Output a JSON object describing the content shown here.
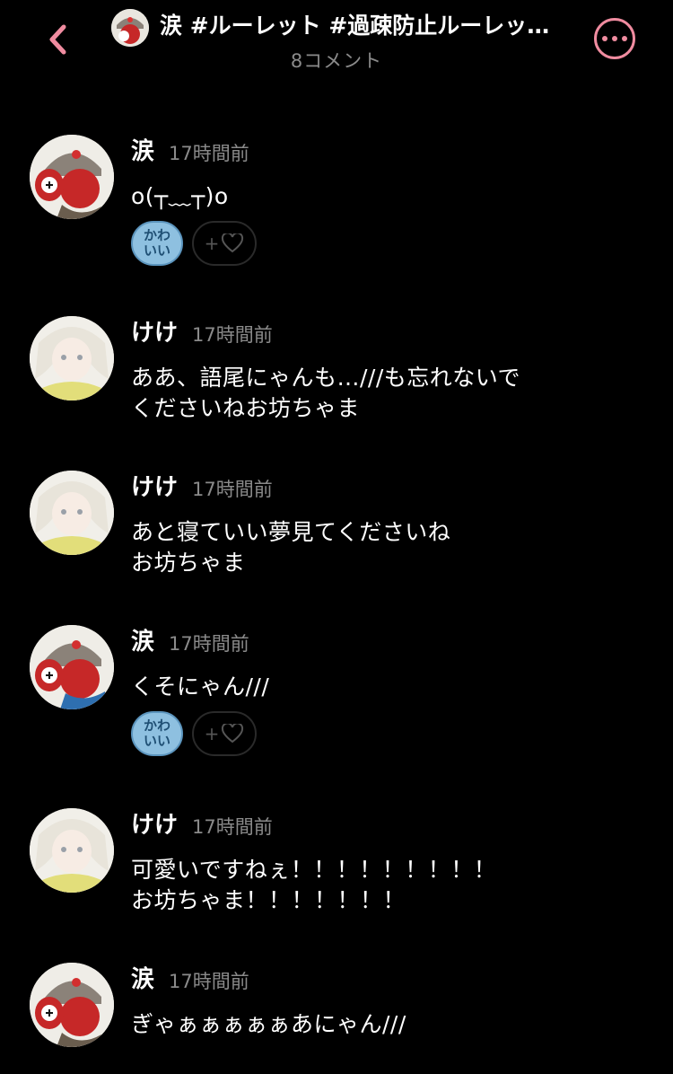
{
  "header": {
    "title": "涙 #ルーレット #過疎防止ルーレッ…",
    "subtitle": "8コメント",
    "accent": "#f08ca0"
  },
  "comments": [
    {
      "user": "涙",
      "time": "17時間前",
      "text": "o(┬﹏┬)o",
      "avatar": "avatar-rui",
      "reactions": {
        "kawaii": "かわいい",
        "add": "+"
      }
    },
    {
      "user": "けけ",
      "time": "17時間前",
      "text": "ああ、語尾にゃんも…///も忘れないで\nくださいねお坊ちゃま",
      "avatar": "avatar-keke"
    },
    {
      "user": "けけ",
      "time": "17時間前",
      "text": "あと寝ていい夢見てくださいね\nお坊ちゃま",
      "avatar": "avatar-keke"
    },
    {
      "user": "涙",
      "time": "17時間前",
      "text": "くそにゃん///",
      "avatar": "avatar-rui",
      "reactions": {
        "kawaii": "かわいい",
        "add": "+"
      }
    },
    {
      "user": "けけ",
      "time": "17時間前",
      "text": "可愛いですねぇ！！！！！！！！！\nお坊ちゃま！！！！！！！",
      "avatar": "avatar-keke"
    },
    {
      "user": "涙",
      "time": "17時間前",
      "text": "ぎゃぁぁぁぁぁあにゃん///",
      "avatar": "avatar-rui"
    }
  ],
  "reaction_labels": {
    "kawaii_line1": "かわ",
    "kawaii_line2": "いい",
    "add": "+"
  }
}
